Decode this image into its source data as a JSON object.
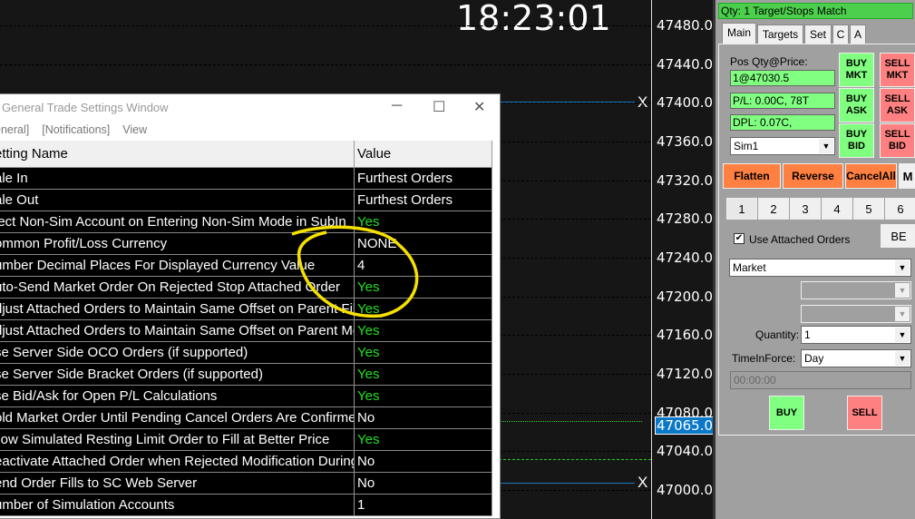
{
  "chart": {
    "clock": "18:23:01",
    "prices": [
      "47480.0",
      "47440.0",
      "47400.0",
      "47360.0",
      "47320.0",
      "47280.0",
      "47240.0",
      "47200.0",
      "47160.0",
      "47120.0",
      "47080.0",
      "47040.0",
      "47000.0"
    ],
    "current_price": "47065.0",
    "x_marker": "X"
  },
  "window": {
    "title": "General Trade Settings Window",
    "menu": [
      "eneral]",
      "[Notifications]",
      "View"
    ],
    "headers": [
      "etting Name",
      "Value"
    ],
    "rows": [
      {
        "name": "ale In",
        "value": "Furthest Orders"
      },
      {
        "name": "ale Out",
        "value": "Furthest Orders"
      },
      {
        "name": "lect Non-Sim Account on Entering Non-Sim Mode in SubIn",
        "value": "Yes"
      },
      {
        "name": "ommon Profit/Loss Currency",
        "value": "NONE"
      },
      {
        "name": "umber Decimal Places For Displayed Currency Value",
        "value": "4"
      },
      {
        "name": "uto-Send Market Order On Rejected Stop Attached Order",
        "value": "Yes"
      },
      {
        "name": "djust Attached Orders to Maintain Same Offset on Parent Fill",
        "value": "Yes"
      },
      {
        "name": "djust Attached Orders to Maintain Same Offset on Parent Mo",
        "value": "Yes"
      },
      {
        "name": "se Server Side OCO Orders (if supported)",
        "value": "Yes"
      },
      {
        "name": "se Server Side Bracket Orders (if supported)",
        "value": "Yes"
      },
      {
        "name": "se Bid/Ask for Open P/L Calculations",
        "value": "Yes"
      },
      {
        "name": "old Market Order Until Pending Cancel Orders Are Confirmed",
        "value": "No"
      },
      {
        "name": "llow Simulated Resting Limit Order to Fill at Better Price",
        "value": "Yes"
      },
      {
        "name": "eactivate Attached Order when Rejected Modification During",
        "value": "No"
      },
      {
        "name": "end Order Fills to SC Web Server",
        "value": "No"
      },
      {
        "name": "umber of Simulation Accounts",
        "value": "1"
      }
    ]
  },
  "panel": {
    "status": "Qty: 1 Target/Stops Match",
    "tabs": [
      "Main",
      "Targets",
      "Set",
      "C",
      "A"
    ],
    "pos_label": "Pos Qty@Price:",
    "pos": "1@47030.5",
    "pl": "P/L: 0.00C, 78T",
    "dpl": "DPL: 0.07C,",
    "account": "Sim1",
    "buy_mkt": "BUY MKT",
    "sell_mkt": "SELL MKT",
    "buy_ask": "BUY ASK",
    "sell_ask": "SELL ASK",
    "buy_bid": "BUY BID",
    "sell_bid": "SELL BID",
    "flatten": "Flatten",
    "reverse": "Reverse",
    "cancel_all": "CancelAll",
    "m": "M",
    "nums": [
      "1",
      "2",
      "3",
      "4",
      "5",
      "6"
    ],
    "use_attached": "Use Attached Orders",
    "be": "BE",
    "order_type": "Market",
    "quantity_label": "Quantity:",
    "quantity": "1",
    "tif_label": "TimeInForce:",
    "tif": "Day",
    "time": "00:00:00",
    "buy": "BUY",
    "sell": "SELL"
  }
}
